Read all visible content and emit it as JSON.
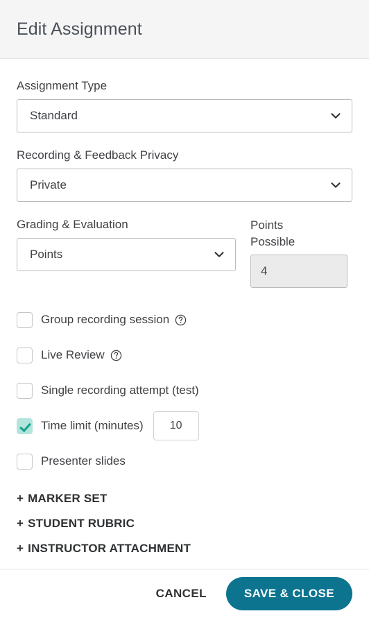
{
  "header": {
    "title": "Edit Assignment"
  },
  "form": {
    "assignment_type": {
      "label": "Assignment Type",
      "value": "Standard",
      "icon": "chevron-down-icon"
    },
    "privacy": {
      "label": "Recording & Feedback Privacy",
      "value": "Private",
      "icon": "chevron-down-icon"
    },
    "grading": {
      "label": "Grading & Evaluation",
      "value": "Points",
      "icon": "chevron-down-icon"
    },
    "points_possible": {
      "label": "Points Possible",
      "value": "4",
      "placeholder": "0"
    }
  },
  "checkboxes": [
    {
      "label": "Group recording session",
      "checked": false,
      "help_icon": "help-circle-icon"
    },
    {
      "label": "Live Review",
      "checked": false,
      "help_icon": "help-circle-icon"
    },
    {
      "label": "Single recording attempt (test)",
      "checked": false,
      "help_icon": null
    },
    {
      "label": "Time limit (minutes)",
      "checked": true,
      "help_icon": null,
      "time_value": "10"
    },
    {
      "label": "Presenter slides",
      "checked": false,
      "help_icon": null
    }
  ],
  "expanders": [
    {
      "plus": "+",
      "label": "MARKER SET"
    },
    {
      "plus": "+",
      "label": "STUDENT RUBRIC"
    },
    {
      "plus": "+",
      "label": "INSTRUCTOR ATTACHMENT"
    }
  ],
  "footer": {
    "cancel_label": "CANCEL",
    "save_label": "SAVE & CLOSE"
  },
  "colors": {
    "accent_teal": "#0d7490",
    "checkbox_checked_bg": "#b2e5dd",
    "checkbox_checked_mark": "#14a08c",
    "header_bg": "#f5f5f5",
    "disabled_input_bg": "#ebebeb",
    "border": "#b9bcbe"
  }
}
